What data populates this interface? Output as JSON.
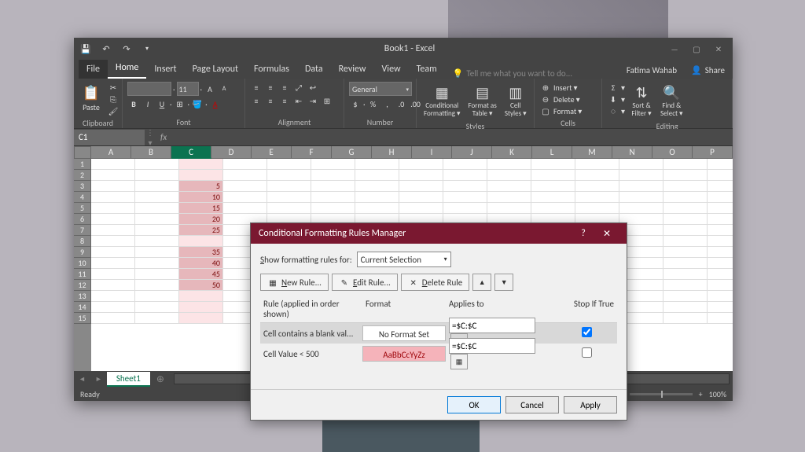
{
  "window": {
    "title": "Book1 - Excel",
    "user": "Fatima Wahab",
    "share": "Share",
    "tell_me": "Tell me what you want to do..."
  },
  "tabs": {
    "file": "File",
    "home": "Home",
    "insert": "Insert",
    "page_layout": "Page Layout",
    "formulas": "Formulas",
    "data": "Data",
    "review": "Review",
    "view": "View",
    "team": "Team"
  },
  "ribbon": {
    "clipboard": {
      "label": "Clipboard",
      "paste": "Paste"
    },
    "font": {
      "label": "Font",
      "name": "",
      "size": "11"
    },
    "alignment": {
      "label": "Alignment"
    },
    "number": {
      "label": "Number",
      "format": "General"
    },
    "styles": {
      "label": "Styles",
      "cond": "Conditional Formatting",
      "fat": "Format as Table",
      "cell": "Cell Styles"
    },
    "cells": {
      "label": "Cells",
      "insert": "Insert",
      "delete": "Delete",
      "format": "Format"
    },
    "editing": {
      "label": "Editing",
      "sort": "Sort & Filter",
      "find": "Find & Select"
    }
  },
  "formula_bar": {
    "namebox": "C1"
  },
  "grid": {
    "columns": [
      "A",
      "B",
      "C",
      "D",
      "E",
      "F",
      "G",
      "H",
      "I",
      "J",
      "K",
      "L",
      "M",
      "N",
      "O",
      "P"
    ],
    "col_c_values": [
      "",
      "",
      "5",
      "10",
      "15",
      "20",
      "25",
      "",
      "35",
      "40",
      "45",
      "50",
      "",
      "",
      ""
    ],
    "selected_column": "C"
  },
  "sheet": {
    "name": "Sheet1"
  },
  "status": {
    "ready": "Ready",
    "zoom": "100%"
  },
  "dialog": {
    "title": "Conditional Formatting Rules Manager",
    "show_label": "Show formatting rules for:",
    "show_value": "Current Selection",
    "new_rule": "New Rule...",
    "edit_rule": "Edit Rule...",
    "delete_rule": "Delete Rule",
    "header_rule": "Rule (applied in order shown)",
    "header_format": "Format",
    "header_applies": "Applies to",
    "header_stop": "Stop If True",
    "rules": [
      {
        "name": "Cell contains a blank val...",
        "format": "No Format Set",
        "applies": "=$C:$C",
        "stop": true,
        "selected": true,
        "pink": false
      },
      {
        "name": "Cell Value < 500",
        "format": "AaBbCcYyZz",
        "applies": "=$C:$C",
        "stop": false,
        "selected": false,
        "pink": true
      }
    ],
    "ok": "OK",
    "cancel": "Cancel",
    "apply": "Apply"
  }
}
